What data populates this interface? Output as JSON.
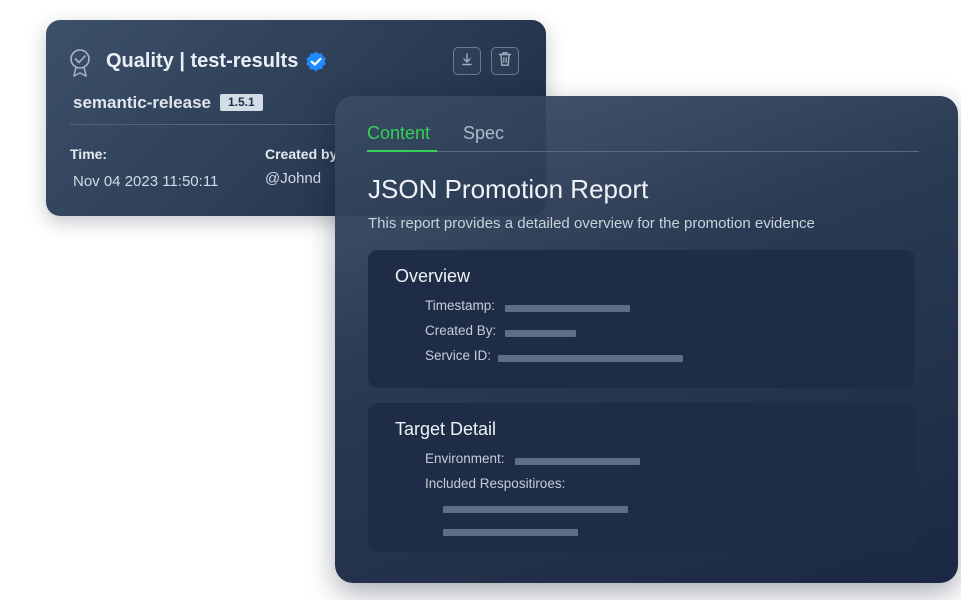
{
  "back_card": {
    "title": "Quality | test-results",
    "package_name": "semantic-release",
    "version": "1.5.1",
    "time_label": "Time:",
    "time_value": "Nov 04 2023  11:50:11",
    "created_by_label": "Created by",
    "created_by_value": "@Johnd",
    "icons": [
      "certificate-icon",
      "verified-badge-icon",
      "download-icon",
      "trash-icon"
    ]
  },
  "front_card": {
    "tabs": [
      {
        "label": "Content",
        "active": true
      },
      {
        "label": "Spec",
        "active": false
      }
    ],
    "title": "JSON Promotion Report",
    "description": "This report provides a detailed overview for the promotion evidence",
    "overview": {
      "title": "Overview",
      "fields": [
        {
          "label": "Timestamp:"
        },
        {
          "label": "Created By:"
        },
        {
          "label": "Service ID:"
        }
      ]
    },
    "target_detail": {
      "title": "Target Detail",
      "fields": [
        {
          "label": "Environment:"
        },
        {
          "label": "Included Respositiroes:"
        }
      ]
    }
  },
  "colors": {
    "accent_green": "#34d058",
    "verified_blue": "#1e8bff",
    "card_dark": "#1f2c46",
    "placeholder": "#5d6f86"
  }
}
